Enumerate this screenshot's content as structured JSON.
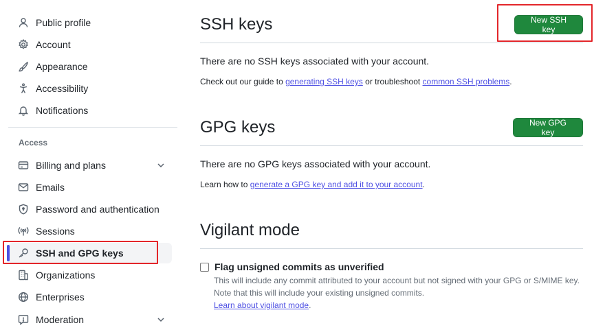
{
  "sidebar": {
    "items_top": [
      {
        "label": "Public profile",
        "icon": "person-icon"
      },
      {
        "label": "Account",
        "icon": "gear-icon"
      },
      {
        "label": "Appearance",
        "icon": "paintbrush-icon"
      },
      {
        "label": "Accessibility",
        "icon": "accessibility-icon"
      },
      {
        "label": "Notifications",
        "icon": "bell-icon"
      }
    ],
    "access_heading": "Access",
    "items_access": [
      {
        "label": "Billing and plans",
        "icon": "credit-card-icon",
        "expandable": true
      },
      {
        "label": "Emails",
        "icon": "mail-icon"
      },
      {
        "label": "Password and authentication",
        "icon": "shield-lock-icon"
      },
      {
        "label": "Sessions",
        "icon": "broadcast-icon"
      },
      {
        "label": "SSH and GPG keys",
        "icon": "key-icon",
        "active": true
      },
      {
        "label": "Organizations",
        "icon": "organization-icon"
      },
      {
        "label": "Enterprises",
        "icon": "globe-icon"
      },
      {
        "label": "Moderation",
        "icon": "report-icon",
        "expandable": true
      }
    ]
  },
  "ssh": {
    "title": "SSH keys",
    "button": "New SSH key",
    "empty": "There are no SSH keys associated with your account.",
    "guide_prefix": "Check out our guide to ",
    "guide_link1": "generating SSH keys",
    "guide_middle": " or troubleshoot ",
    "guide_link2": "common SSH problems",
    "guide_suffix": "."
  },
  "gpg": {
    "title": "GPG keys",
    "button": "New GPG key",
    "empty": "There are no GPG keys associated with your account.",
    "learn_prefix": "Learn how to ",
    "learn_link": "generate a GPG key and add it to your account",
    "learn_suffix": "."
  },
  "vigilant": {
    "title": "Vigilant mode",
    "checkbox_label": "Flag unsigned commits as unverified",
    "checked": false,
    "note_line1": "This will include any commit attributed to your account but not signed with your GPG or S/MIME key.",
    "note_line2": "Note that this will include your existing unsigned commits.",
    "note_link": "Learn about vigilant mode",
    "note_suffix": "."
  },
  "colors": {
    "primary_button": "#1f883d",
    "link": "#4d4fe3",
    "highlight": "#e3262a",
    "active_indicator": "#4d4fe3"
  }
}
